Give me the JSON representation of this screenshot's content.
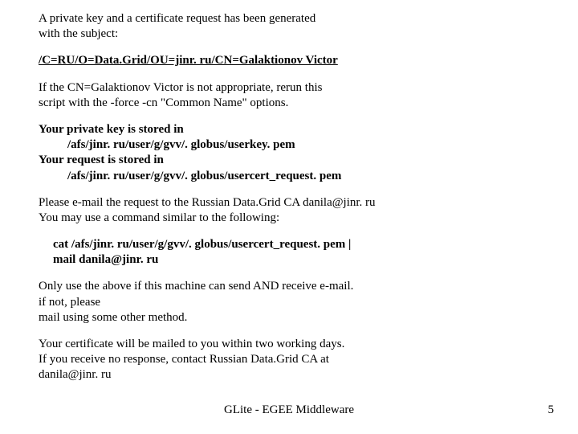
{
  "intro_line1": "A private key and a certificate request has been generated",
  "intro_line2": "with the subject:",
  "subject_dn": "/C=RU/O=Data.Grid/OU=jinr. ru/CN=Galaktionov Victor",
  "cn_warn_line1": "If the CN=Galaktionov Victor is not appropriate, rerun this",
  "cn_warn_line2": "script with the -force -cn \"Common Name\" options.",
  "pk_label": "Your private key is stored in",
  "pk_path": "/afs/jinr. ru/user/g/gvv/. globus/userkey. pem",
  "req_label": "Your request is stored in",
  "req_path": "/afs/jinr. ru/user/g/gvv/. globus/usercert_request. pem",
  "email_line1": "Please e-mail the request to the Russian Data.Grid CA danila@jinr. ru",
  "email_line2": "You may use a command similar to the following:",
  "cmd_line1": "cat /afs/jinr. ru/user/g/gvv/. globus/usercert_request. pem |",
  "cmd_line2": "mail danila@jinr. ru",
  "cond_line1": "Only use the above if this machine can send AND receive e-mail.",
  "cond_line2": " if not, please",
  "cond_line3": "mail using some other method.",
  "closing_line1": "Your certificate will be mailed to you within two working days.",
  "closing_line2": "If you receive no response, contact Russian Data.Grid CA at",
  "closing_line3": "danila@jinr. ru",
  "footer_center": "GLite - EGEE Middleware",
  "footer_page": "5"
}
